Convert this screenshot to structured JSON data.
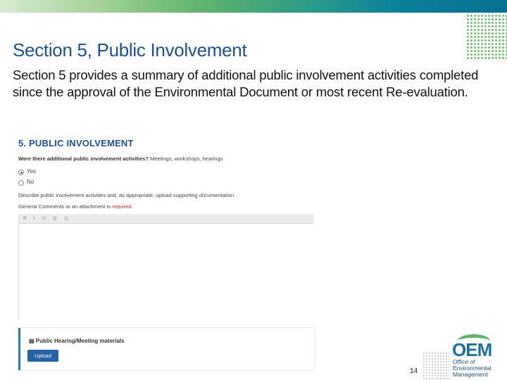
{
  "slide": {
    "title": "Section 5, Public Involvement",
    "intro_bold": "Section 5",
    "intro_rest": "  provides a summary of additional public involvement activities completed since the approval of the Environmental Document or most recent Re-evaluation.",
    "page_number": "14"
  },
  "form": {
    "heading": "5. PUBLIC INVOLVEMENT",
    "question_bold": "Were there additional public involvement activities?",
    "question_rest": " Meetings, workshops, hearings",
    "options": [
      {
        "label": "Yes",
        "selected": true
      },
      {
        "label": "No",
        "selected": false
      }
    ],
    "description": "Describe public involvement activities and, as appropriate, upload supporting documentation.",
    "comment_prefix": "General Comments or an attachment is ",
    "comment_required": "required.",
    "toolbar": [
      "B",
      "I",
      "U",
      "☰",
      "☷"
    ],
    "attachment_title": "Public Hearing/Meeting materials",
    "upload_label": "Upload"
  },
  "logo": {
    "acronym": "OEM",
    "line1": "Office of",
    "line2": "Environmental",
    "line3": "Management"
  },
  "colors": {
    "accent": "#1d4f91",
    "button": "#2563a8",
    "required": "#c0392b"
  }
}
